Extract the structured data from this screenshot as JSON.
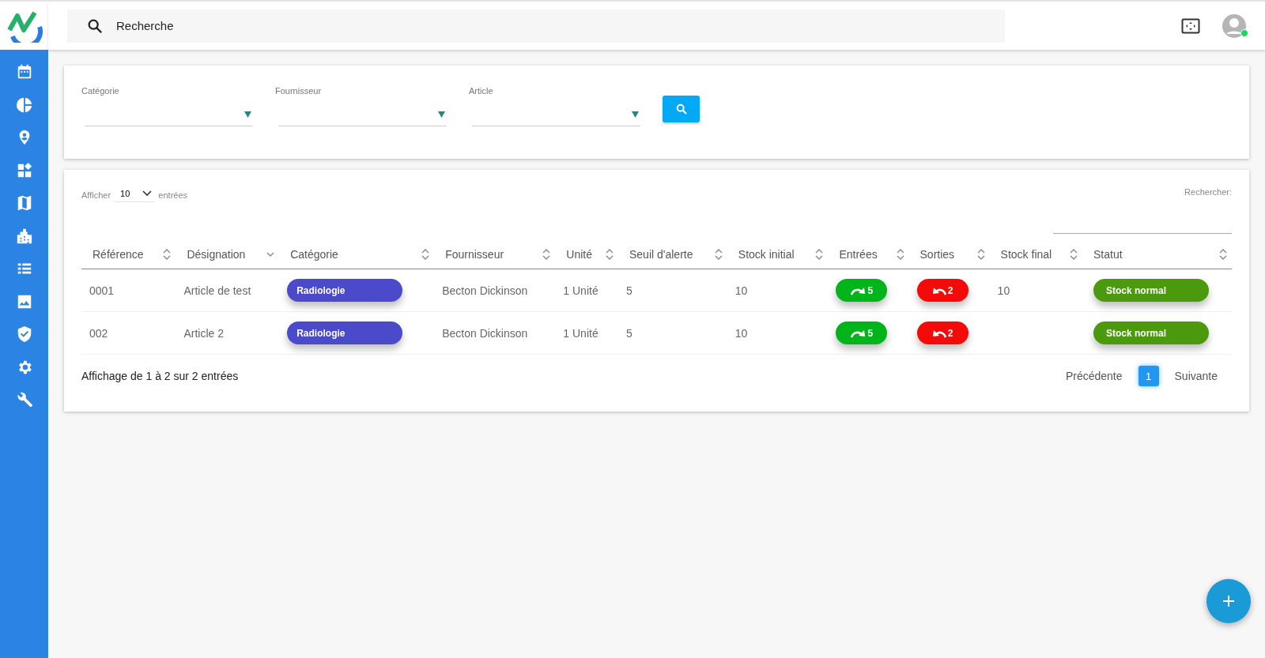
{
  "topbar": {
    "search_placeholder": "Recherche",
    "user_online": true
  },
  "filters": [
    {
      "label": "Catégorie"
    },
    {
      "label": "Fournisseur"
    },
    {
      "label": "Article"
    }
  ],
  "table_controls": {
    "show_label": "Afficher",
    "page_size": "10",
    "entries_label": "entrées",
    "search_label": "Rechercher:"
  },
  "table": {
    "columns": [
      {
        "label": "Référence",
        "kind": "sortable"
      },
      {
        "label": "Désignation",
        "kind": "sorted_desc"
      },
      {
        "label": "Catégorie",
        "kind": "sortable"
      },
      {
        "label": "Fournisseur",
        "kind": "sortable"
      },
      {
        "label": "Unité",
        "kind": "sortable"
      },
      {
        "label": "Seuil d'alerte",
        "kind": "sortable"
      },
      {
        "label": "Stock initial",
        "kind": "sortable"
      },
      {
        "label": "Entrées",
        "kind": "sortable"
      },
      {
        "label": "Sorties",
        "kind": "sortable"
      },
      {
        "label": "Stock final",
        "kind": "sortable"
      },
      {
        "label": "Statut",
        "kind": "sortable"
      }
    ],
    "rows": [
      {
        "reference": "0001",
        "designation": "Article de test",
        "category": "Radiologie",
        "supplier": "Becton Dickinson",
        "unit": "1 Unité",
        "alert": "5",
        "initial": "10",
        "entries": "5",
        "exits": "2",
        "final": "10",
        "status": "Stock normal"
      },
      {
        "reference": "002",
        "designation": "Article 2",
        "category": "Radiologie",
        "supplier": "Becton Dickinson",
        "unit": "1 Unité",
        "alert": "5",
        "initial": "10",
        "entries": "5",
        "exits": "2",
        "status": "Stock normal"
      }
    ]
  },
  "footer": {
    "info": "Affichage de 1 à 2 sur 2 entrées",
    "previous": "Précédente",
    "next": "Suivante",
    "pages": [
      {
        "label": "1",
        "selected": true
      }
    ]
  }
}
